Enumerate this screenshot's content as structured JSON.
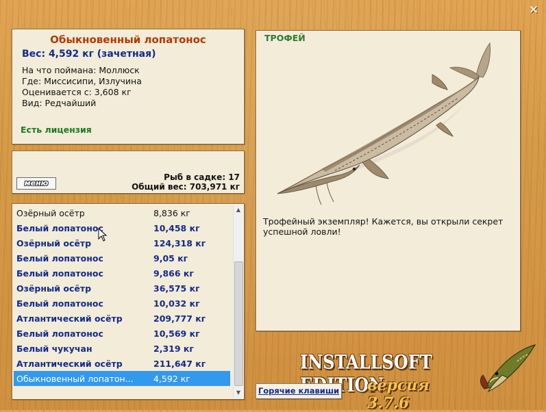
{
  "window": {
    "close_icon": "close-icon"
  },
  "info": {
    "fish_name": "Обыкновенный лопатонос",
    "weight": "Вес: 4,592 кг (зачетная)",
    "details": [
      "На что поймана: Моллюск",
      "Где: Миссисипи, Излучина",
      "Оценивается с: 3,608 кг",
      "Вид: Редчайший"
    ],
    "license": "Есть лицензия"
  },
  "keep": {
    "menu_label": "меню",
    "fish_count": "Рыб в садке: 17",
    "total_weight": "Общий вес: 703,971 кг"
  },
  "catch_list": [
    {
      "name": "Озёрный осётр",
      "weight": "8,836 кг"
    },
    {
      "name": "Белый лопатонос",
      "weight": "10,458 кг"
    },
    {
      "name": "Озёрный осётр",
      "weight": "124,318 кг"
    },
    {
      "name": "Белый лопатонос",
      "weight": "9,05 кг"
    },
    {
      "name": "Белый лопатонос",
      "weight": "9,866 кг"
    },
    {
      "name": "Озёрный осётр",
      "weight": "36,575 кг"
    },
    {
      "name": "Белый лопатонос",
      "weight": "10,032 кг"
    },
    {
      "name": "Атлантический осётр",
      "weight": "209,777 кг"
    },
    {
      "name": "Белый лопатонос",
      "weight": "10,569 кг"
    },
    {
      "name": "Белый чукучан",
      "weight": "2,319 кг"
    },
    {
      "name": "Атлантический осётр",
      "weight": "211,647 кг"
    },
    {
      "name": "Обыкновенный лопатон...",
      "weight": "4,592 кг"
    }
  ],
  "selected_index": 11,
  "trophy": {
    "label": "Трофей",
    "text": "Трофейный экземпляр! Кажется, вы открыли секрет успешной ловли!"
  },
  "edition": {
    "title": "INSTALLSOFT EDITION",
    "version": "версия 3.7.6"
  },
  "hotkeys_label": "Горячие клавиши",
  "colors": {
    "accent_title": "#b23a00",
    "link_blue": "#132a8a",
    "license_green": "#1e7a1e",
    "selection": "#3399ee"
  }
}
